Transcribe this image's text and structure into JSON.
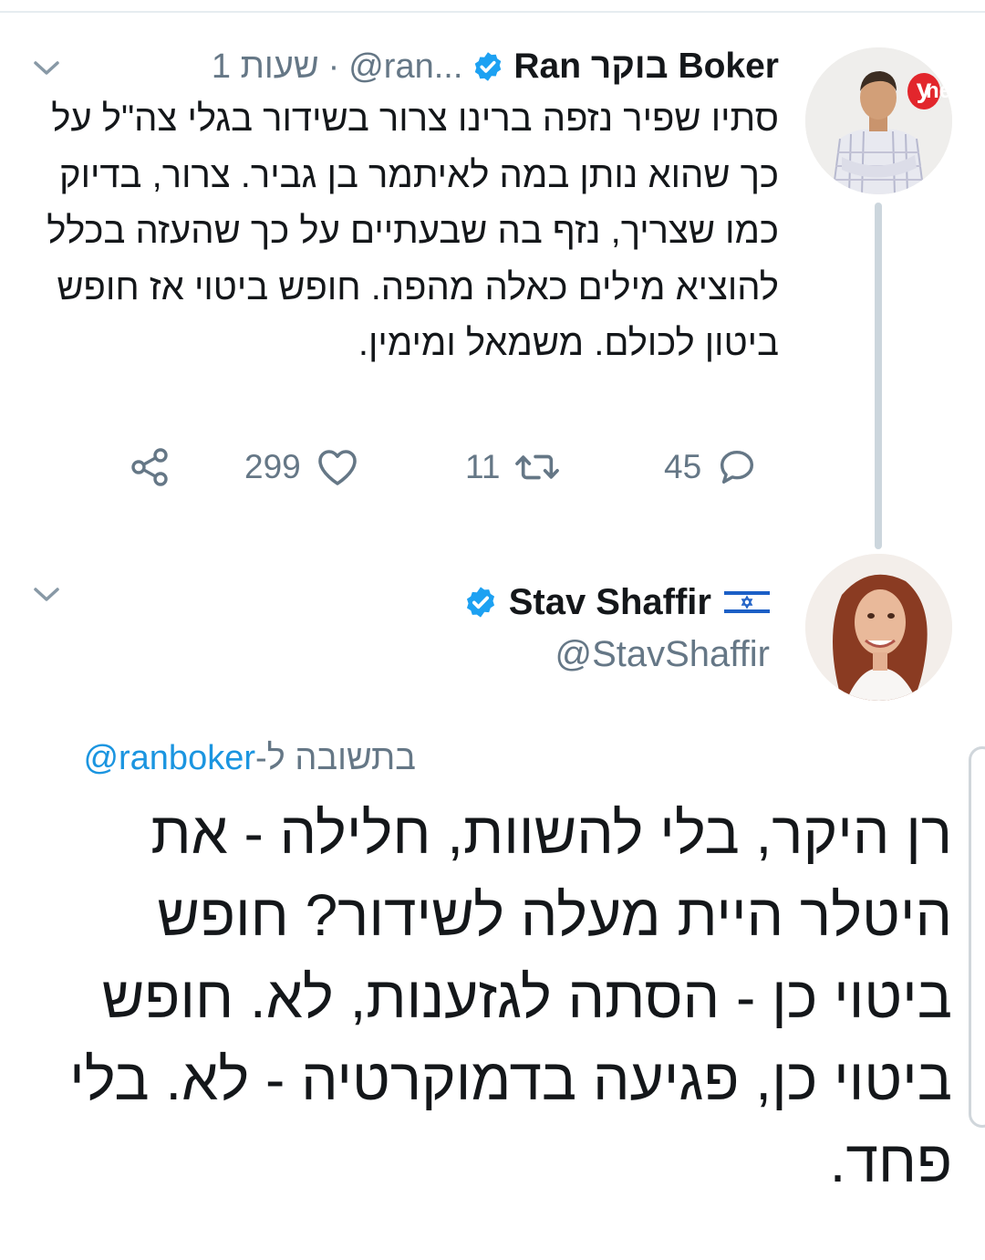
{
  "tweet1": {
    "name": "Ran בוקר Boker",
    "handle": "@ran...",
    "dot": "·",
    "time": "1 שעות",
    "text": "סתיו שפיר נזפה ברינו צרור בשידור בגלי צה\"ל על כך שהוא נותן במה לאיתמר בן גביר. צרור, בדיוק כמו שצריך, נזף בה שבעתיים על כך שהעזה בכלל להוציא מילים כאלה מהפה. חופש ביטוי אז חופש ביטון לכולם. משמאל ומימין.",
    "avatar_badge": "y",
    "avatar_badge_suffix": "net",
    "replies": "45",
    "retweets": "11",
    "likes": "299"
  },
  "tweet2": {
    "name": "Stav Shaffir",
    "handle": "@StavShaffir",
    "reply_prefix": "בתשובה ל-",
    "reply_handle": "@ranboker",
    "text": "רן היקר, בלי להשוות, חלילה - את היטלר היית מעלה לשידור? חופש ביטוי כן - הסתה לגזענות, לא. חופש ביטוי כן, פגיעה בדמוקרטיה - לא. בלי פחד."
  },
  "icons": {
    "verified": "verified-badge-icon",
    "chevron": "chevron-down-icon",
    "reply": "reply-icon",
    "retweet": "retweet-icon",
    "like": "heart-icon",
    "share": "share-icon",
    "flag": "israel-flag-icon"
  },
  "colors": {
    "verified_blue": "#1da1f2",
    "link_blue": "#1b95e0",
    "secondary_text": "#657786",
    "thread_line": "#ccd6dd",
    "ynet_red": "#e2262c"
  }
}
